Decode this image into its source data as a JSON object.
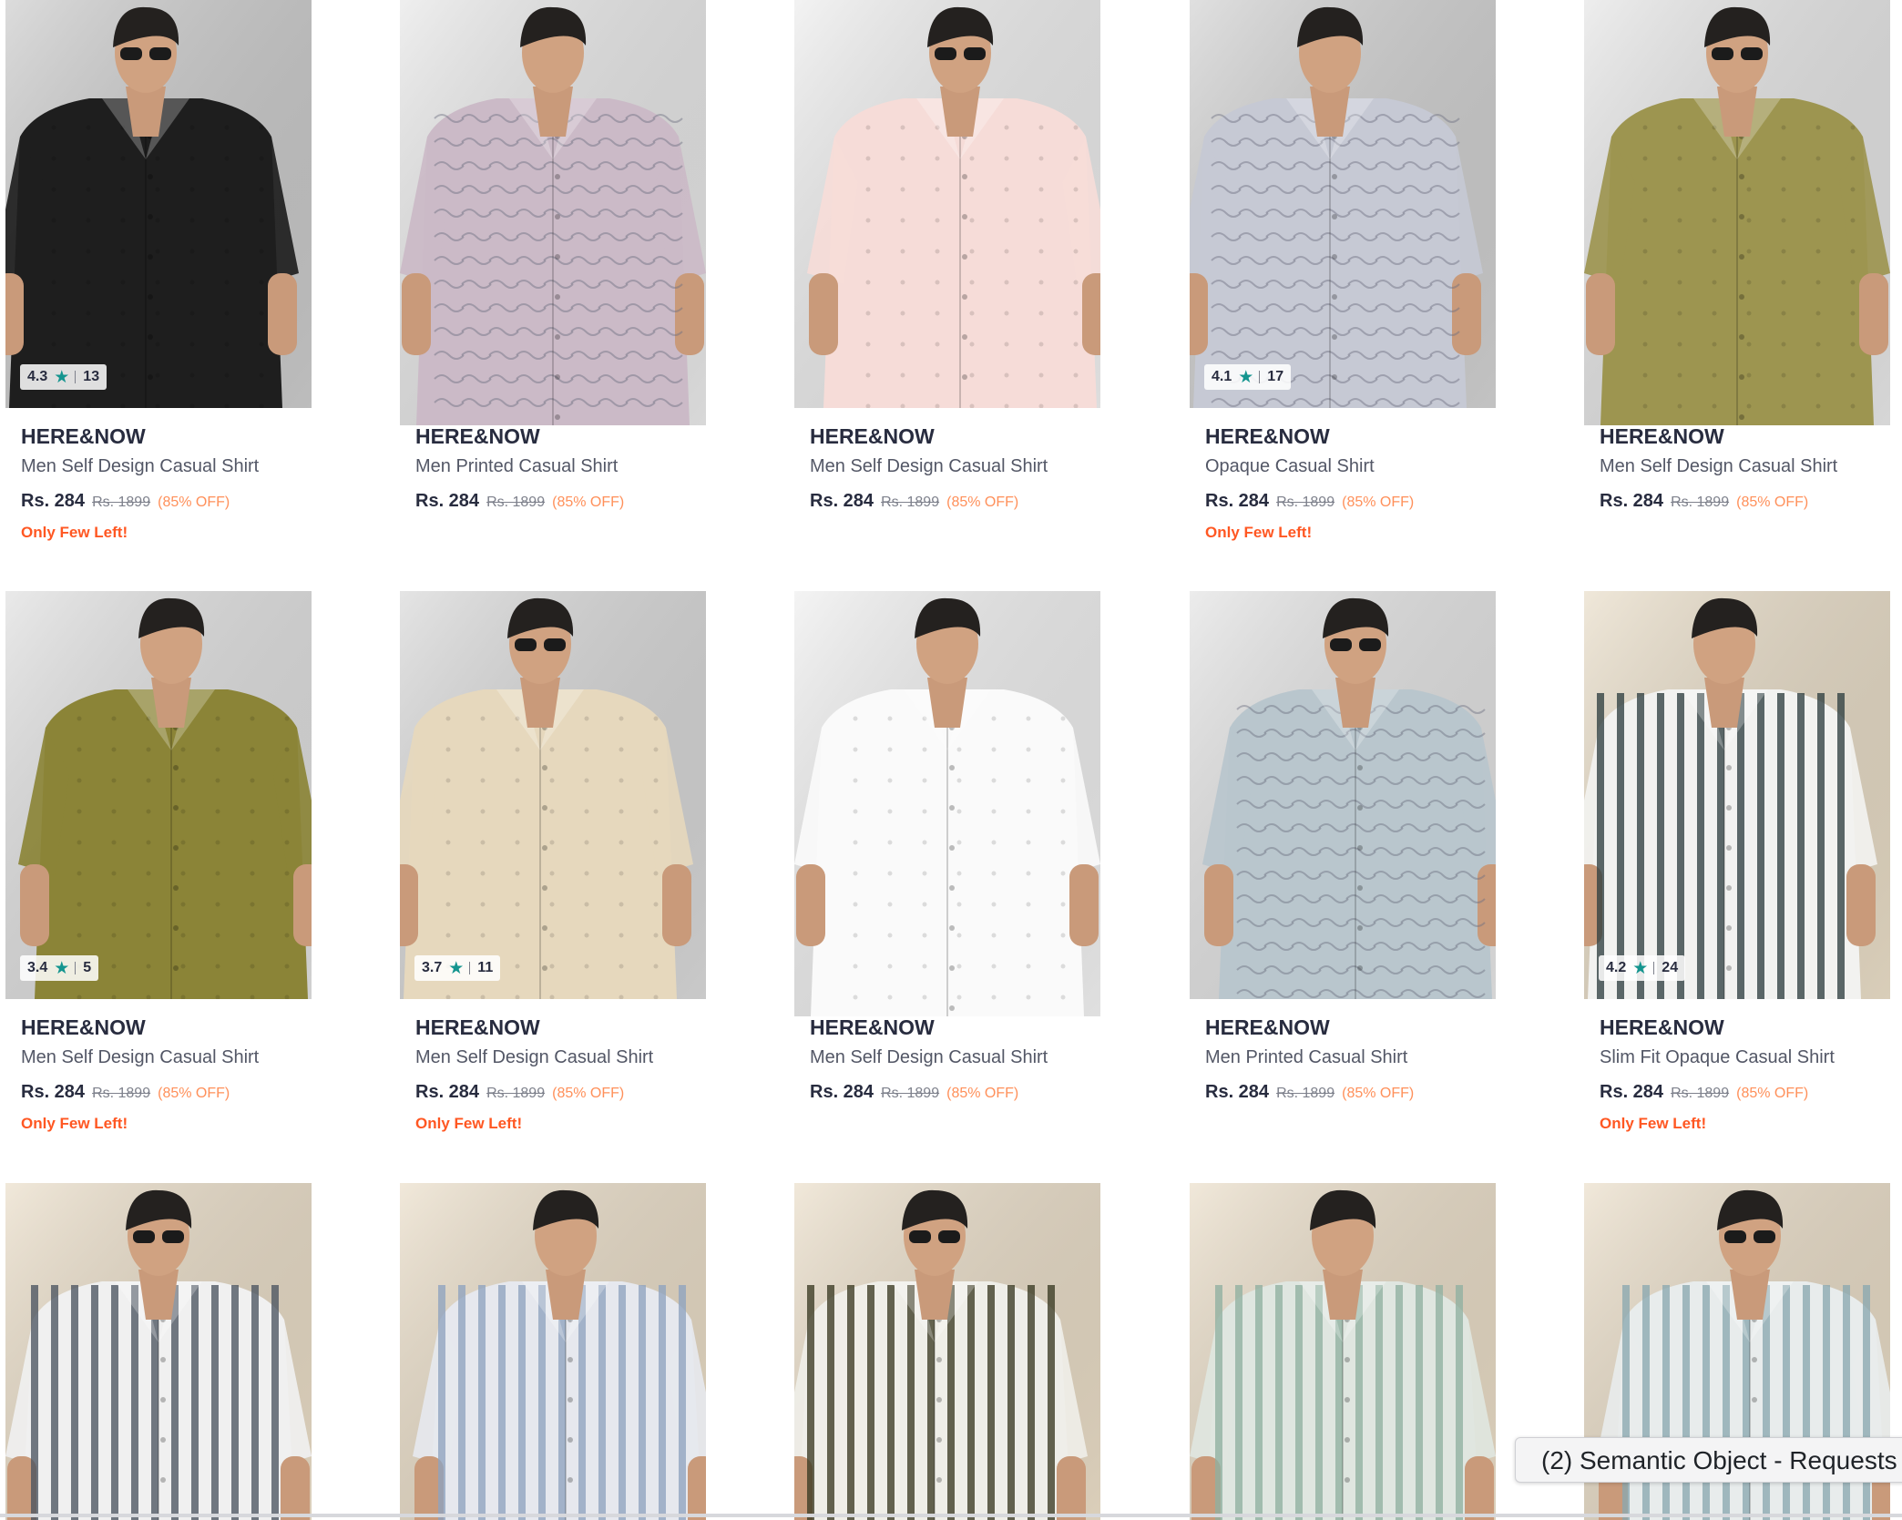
{
  "tooltip": {
    "text": "(2) Semantic Object - Requests"
  },
  "products": [
    {
      "brand": "HERE&NOW",
      "name": "Men Self Design Casual Shirt",
      "price": "Rs. 284",
      "mrp": "Rs. 1899",
      "discount": "(85% OFF)",
      "rating": "4.3",
      "rating_count": "13",
      "stock_note": "Only Few Left!",
      "bg": "#c9c9c9",
      "shirt": "#1e1e1e",
      "pattern": "none"
    },
    {
      "brand": "HERE&NOW",
      "name": "Men Printed Casual Shirt",
      "price": "Rs. 284",
      "mrp": "Rs. 1899",
      "discount": "(85% OFF)",
      "rating": "",
      "rating_count": "",
      "stock_note": "",
      "bg": "#e6e6e6",
      "shirt": "#cbbac7",
      "pattern": "print"
    },
    {
      "brand": "HERE&NOW",
      "name": "Men Self Design Casual Shirt",
      "price": "Rs. 284",
      "mrp": "Rs. 1899",
      "discount": "(85% OFF)",
      "rating": "",
      "rating_count": "",
      "stock_note": "",
      "bg": "#ececec",
      "shirt": "#f6dcd8",
      "pattern": "none"
    },
    {
      "brand": "HERE&NOW",
      "name": "Opaque Casual Shirt",
      "price": "Rs. 284",
      "mrp": "Rs. 1899",
      "discount": "(85% OFF)",
      "rating": "4.1",
      "rating_count": "17",
      "stock_note": "Only Few Left!",
      "bg": "#cfcfcf",
      "shirt": "#c6c9d4",
      "pattern": "print"
    },
    {
      "brand": "HERE&NOW",
      "name": "Men Self Design Casual Shirt",
      "price": "Rs. 284",
      "mrp": "Rs. 1899",
      "discount": "(85% OFF)",
      "rating": "",
      "rating_count": "",
      "stock_note": "",
      "bg": "#e4e4e4",
      "shirt": "#9d9550",
      "pattern": "none"
    },
    {
      "brand": "HERE&NOW",
      "name": "Men Self Design Casual Shirt",
      "price": "Rs. 284",
      "mrp": "Rs. 1899",
      "discount": "(85% OFF)",
      "rating": "3.4",
      "rating_count": "5",
      "stock_note": "Only Few Left!",
      "bg": "#dedede",
      "shirt": "#8b8437",
      "pattern": "none"
    },
    {
      "brand": "HERE&NOW",
      "name": "Men Self Design Casual Shirt",
      "price": "Rs. 284",
      "mrp": "Rs. 1899",
      "discount": "(85% OFF)",
      "rating": "3.7",
      "rating_count": "11",
      "stock_note": "Only Few Left!",
      "bg": "#d6d6d6",
      "shirt": "#e6d8bd",
      "pattern": "none"
    },
    {
      "brand": "HERE&NOW",
      "name": "Men Self Design Casual Shirt",
      "price": "Rs. 284",
      "mrp": "Rs. 1899",
      "discount": "(85% OFF)",
      "rating": "",
      "rating_count": "",
      "stock_note": "",
      "bg": "#eeeeee",
      "shirt": "#fafafa",
      "pattern": "none"
    },
    {
      "brand": "HERE&NOW",
      "name": "Men Printed Casual Shirt",
      "price": "Rs. 284",
      "mrp": "Rs. 1899",
      "discount": "(85% OFF)",
      "rating": "",
      "rating_count": "",
      "stock_note": "",
      "bg": "#e2e2e2",
      "shirt": "#b9c6cd",
      "pattern": "print"
    },
    {
      "brand": "HERE&NOW",
      "name": "Slim Fit Opaque Casual Shirt",
      "price": "Rs. 284",
      "mrp": "Rs. 1899",
      "discount": "(85% OFF)",
      "rating": "4.2",
      "rating_count": "24",
      "stock_note": "Only Few Left!",
      "bg": "#e7dbc5",
      "shirt": "#f2f2f0",
      "pattern": "stripes",
      "stripe": "#2f3f40"
    },
    {
      "brand": "",
      "name": "",
      "price": "",
      "mrp": "",
      "discount": "",
      "rating": "",
      "rating_count": "",
      "stock_note": "",
      "bg": "#e9dcc6",
      "shirt": "#f0f0f0",
      "pattern": "stripes",
      "stripe": "#4b5560"
    },
    {
      "brand": "",
      "name": "",
      "price": "",
      "mrp": "",
      "discount": "",
      "rating": "",
      "rating_count": "",
      "stock_note": "",
      "bg": "#e9dcc6",
      "shirt": "#e6e8ee",
      "pattern": "stripes",
      "stripe": "#8ea3bf"
    },
    {
      "brand": "",
      "name": "",
      "price": "",
      "mrp": "",
      "discount": "",
      "rating": "",
      "rating_count": "",
      "stock_note": "",
      "bg": "#e9dcc6",
      "shirt": "#efeee8",
      "pattern": "stripes",
      "stripe": "#3a3a22"
    },
    {
      "brand": "",
      "name": "",
      "price": "",
      "mrp": "",
      "discount": "",
      "rating": "",
      "rating_count": "",
      "stock_note": "",
      "bg": "#e9dcc6",
      "shirt": "#dfe6e0",
      "pattern": "stripes",
      "stripe": "#8fb0a0"
    },
    {
      "brand": "",
      "name": "",
      "price": "",
      "mrp": "",
      "discount": "",
      "rating": "",
      "rating_count": "",
      "stock_note": "",
      "bg": "#e9dcc6",
      "shirt": "#e8ecec",
      "pattern": "stripes",
      "stripe": "#8aa8b0"
    }
  ]
}
